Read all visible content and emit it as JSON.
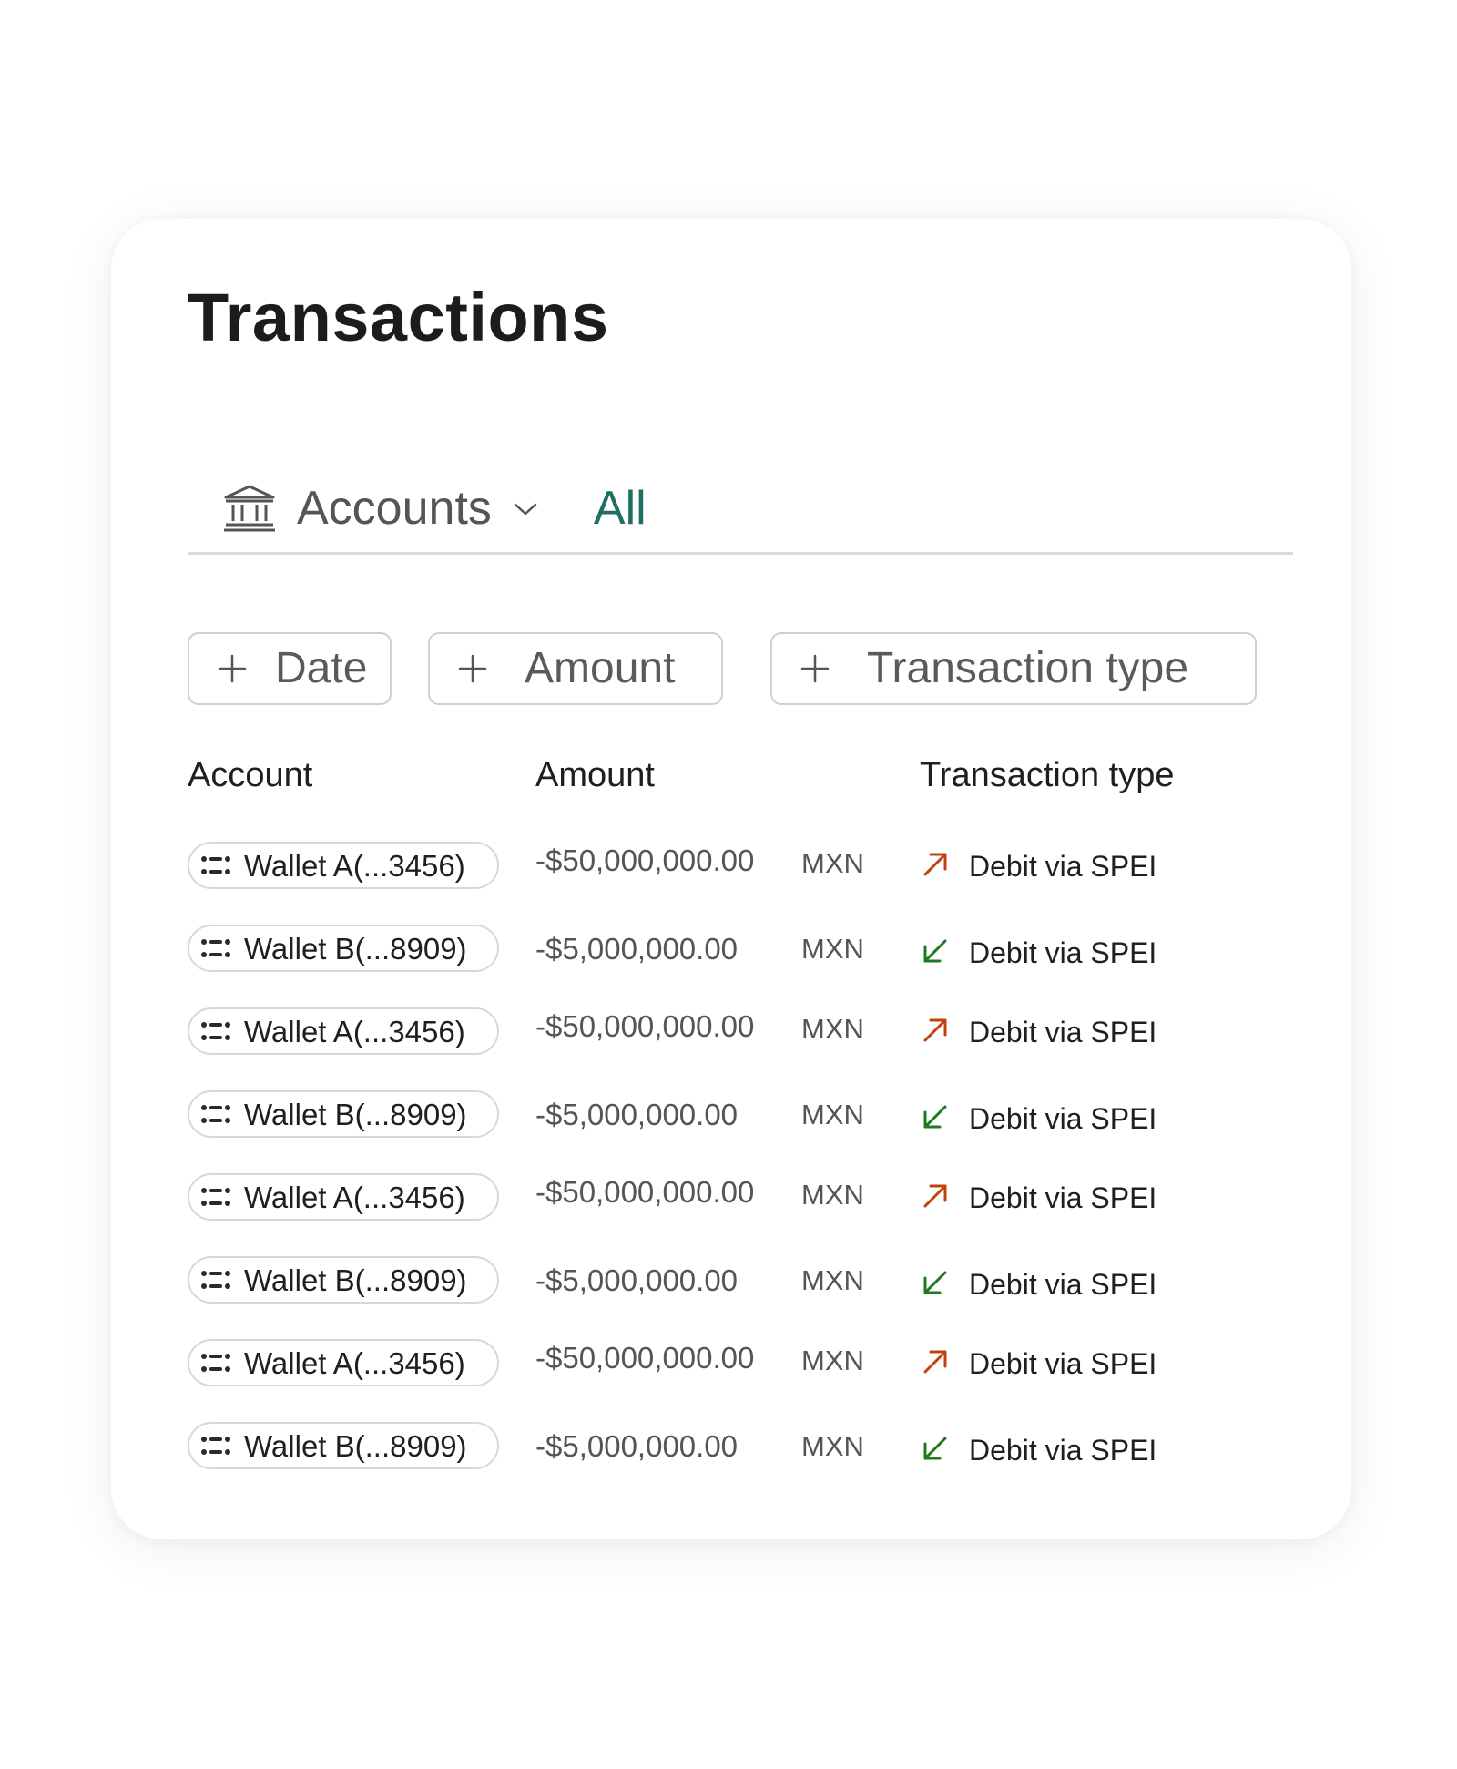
{
  "page": {
    "title": "Transactions"
  },
  "account_filter": {
    "icon": "bank-icon",
    "label": "Accounts",
    "dropdown_icon": "chevron-down-icon",
    "selected": "All",
    "selected_color": "#1f6f62"
  },
  "filters": [
    {
      "icon": "plus-icon",
      "label": "Date"
    },
    {
      "icon": "plus-icon",
      "label": "Amount"
    },
    {
      "icon": "plus-icon",
      "label": "Transaction type"
    }
  ],
  "table": {
    "columns": [
      "Account",
      "Amount",
      "Transaction type"
    ],
    "rows": [
      {
        "account": "Wallet A(...3456)",
        "amount": "-$50,000,000.00",
        "currency": "MXN",
        "direction": "outgoing",
        "type": "Debit via SPEI"
      },
      {
        "account": "Wallet B(...8909)",
        "amount": "-$5,000,000.00",
        "currency": "MXN",
        "direction": "incoming",
        "type": "Debit via SPEI"
      },
      {
        "account": "Wallet A(...3456)",
        "amount": "-$50,000,000.00",
        "currency": "MXN",
        "direction": "outgoing",
        "type": "Debit via SPEI"
      },
      {
        "account": "Wallet B(...8909)",
        "amount": "-$5,000,000.00",
        "currency": "MXN",
        "direction": "incoming",
        "type": "Debit via SPEI"
      },
      {
        "account": "Wallet A(...3456)",
        "amount": "-$50,000,000.00",
        "currency": "MXN",
        "direction": "outgoing",
        "type": "Debit via SPEI"
      },
      {
        "account": "Wallet B(...8909)",
        "amount": "-$5,000,000.00",
        "currency": "MXN",
        "direction": "incoming",
        "type": "Debit via SPEI"
      },
      {
        "account": "Wallet A(...3456)",
        "amount": "-$50,000,000.00",
        "currency": "MXN",
        "direction": "outgoing",
        "type": "Debit via SPEI"
      },
      {
        "account": "Wallet B(...8909)",
        "amount": "-$5,000,000.00",
        "currency": "MXN",
        "direction": "incoming",
        "type": "Debit via SPEI"
      }
    ]
  },
  "icons": {
    "wallet": "wallet-icon",
    "outgoing": "arrow-up-right-icon",
    "incoming": "arrow-down-left-icon"
  },
  "colors": {
    "outgoing": "#c2410c",
    "incoming": "#1f7a1f"
  }
}
